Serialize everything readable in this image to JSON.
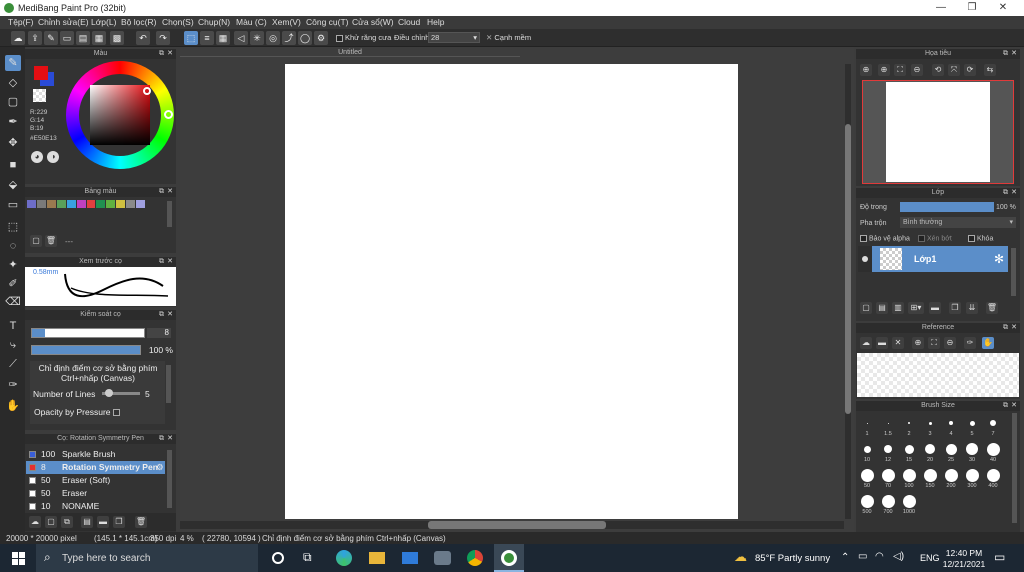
{
  "window": {
    "title": "MediBang Paint Pro (32bit)",
    "min": "—",
    "max": "❐",
    "close": "✕"
  },
  "menu": [
    "Tệp(F)",
    "Chỉnh sửa(E)",
    "Lớp(L)",
    "Bộ lọc(R)",
    "Chọn(S)",
    "Chụp(N)",
    "Màu (C)",
    "Xem(V)",
    "Công cụ(T)",
    "Cửa sổ(W)",
    "Cloud",
    "Help"
  ],
  "toolbar": {
    "antialias": "Khử răng cưa",
    "adjust_label": "Điều chỉnh",
    "adjust_value": "28",
    "smoothing": "Cạnh mềm"
  },
  "canvas": {
    "tab": "Untitled"
  },
  "color_panel": {
    "title": "Màu",
    "r": "R:229",
    "g": "G:14",
    "b": "B:19",
    "hex": "#E50E13",
    "accent": "#E50E13"
  },
  "palette_panel": {
    "title": "Bảng màu",
    "dash": "---"
  },
  "brush_preview": {
    "title": "Xem trước cọ",
    "size": "0.58mm"
  },
  "brush_control": {
    "title": "Kiểm soát cọ",
    "size_value": "8",
    "opacity_value": "100 %",
    "hint": "Chỉ định điểm cơ sở bằng phím Ctrl+nhấp (Canvas)",
    "lines_label": "Number of Lines",
    "lines_value": "5",
    "opacity_pressure": "Opacity by Pressure"
  },
  "brush_list": {
    "title": "Cọ: Rotation Symmetry Pen",
    "items": [
      {
        "size": "100",
        "name": "Sparkle Brush",
        "color": "#3a5fd9"
      },
      {
        "size": "8",
        "name": "Rotation Symmetry Pen",
        "color": "#e53030"
      },
      {
        "size": "50",
        "name": "Eraser (Soft)",
        "color": "#ffffff"
      },
      {
        "size": "50",
        "name": "Eraser",
        "color": "#ffffff"
      },
      {
        "size": "10",
        "name": "NONAME",
        "color": "#ffffff"
      }
    ]
  },
  "navigator": {
    "title": "Họa tiêu"
  },
  "layer_panel": {
    "title": "Lớp",
    "opacity_label": "Độ trong",
    "opacity_value": "100 %",
    "blend_label": "Pha trộn",
    "blend_value": "Bình thường",
    "protect_alpha": "Bảo vệ alpha",
    "clip": "Xén bớt",
    "lock": "Khóa",
    "layer_name": "Lớp1"
  },
  "reference": {
    "title": "Reference"
  },
  "brush_size": {
    "title": "Brush Size",
    "labels": [
      "1",
      "1.5",
      "2",
      "3",
      "4",
      "5",
      "7",
      "10",
      "12",
      "15",
      "20",
      "25",
      "30",
      "40",
      "50",
      "70",
      "100",
      "150",
      "200",
      "300",
      "400",
      "500",
      "700",
      "1000"
    ]
  },
  "status": {
    "dims": "20000 * 20000 pixel",
    "mm": "(145.1 * 145.1cm)",
    "dpi": "350 dpi",
    "zoom": "4 %",
    "coords": "( 22780, 10594 )",
    "hint": "Chỉ định điểm cơ sở bằng phím Ctrl+nhấp (Canvas)"
  },
  "taskbar": {
    "search": "Type here to search",
    "weather": "85°F  Partly sunny",
    "lang": "ENG",
    "time": "12:40 PM",
    "date": "12/21/2021"
  }
}
